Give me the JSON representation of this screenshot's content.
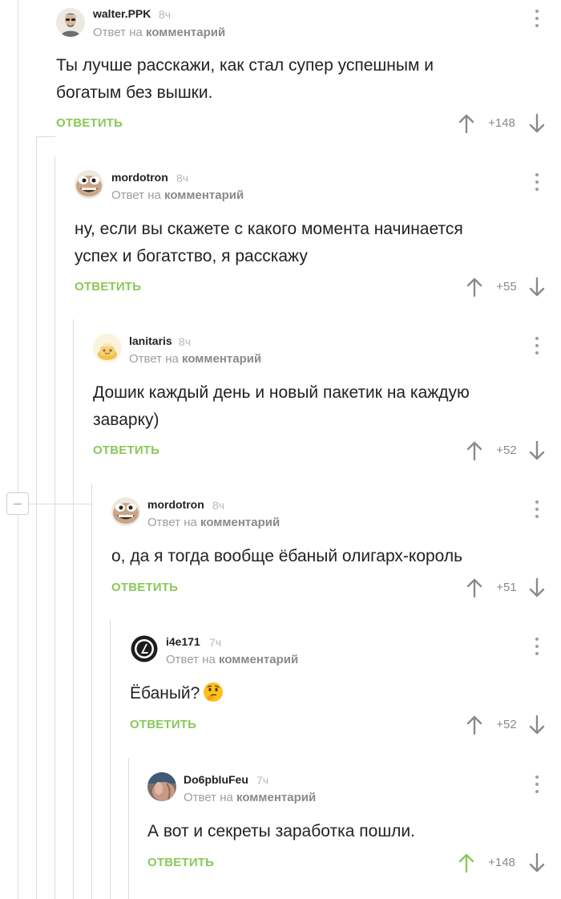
{
  "reply_to_prefix": "Ответ на",
  "reply_to_target": "комментарий",
  "reply_label": "ОТВЕТИТЬ",
  "colors": {
    "accent_green": "#8ac858",
    "upvoted_green": "#8ac858",
    "text": "#222222",
    "muted": "#9e9e9e"
  },
  "comments": [
    {
      "author": "walter.PPK",
      "time": "8ч",
      "avatar_icon": "user-avatar-icon",
      "lines": [
        "Ты лучше расскажи, как стал супер успешным и",
        "богатым без вышки."
      ],
      "rating": "+148",
      "upvoted": false
    },
    {
      "author": "mordotron",
      "time": "8ч",
      "avatar_icon": "user-avatar-icon",
      "lines": [
        "ну, если вы скажете с какого момента начинается",
        "успех и богатство, я расскажу"
      ],
      "rating": "+55",
      "upvoted": false
    },
    {
      "author": "lanitaris",
      "time": "8ч",
      "avatar_icon": "user-avatar-icon",
      "lines": [
        "Дошик каждый день и новый пакетик на каждую",
        "заварку)"
      ],
      "rating": "+52",
      "upvoted": false
    },
    {
      "author": "mordotron",
      "time": "8ч",
      "avatar_icon": "user-avatar-icon",
      "lines": [
        "о, да я тогда вообще ёбаный олигарх-король"
      ],
      "rating": "+51",
      "upvoted": false
    },
    {
      "author": "i4e171",
      "time": "7ч",
      "avatar_icon": "user-avatar-icon",
      "lines": [
        "Ёбаный?"
      ],
      "emoji": "thinking-face-emoji",
      "rating": "+52",
      "upvoted": false
    },
    {
      "author": "Do6pbIuFeu",
      "time": "7ч",
      "avatar_icon": "user-avatar-icon",
      "lines": [
        "А вот и секреты заработка пошли."
      ],
      "rating": "+148",
      "upvoted": true
    }
  ]
}
